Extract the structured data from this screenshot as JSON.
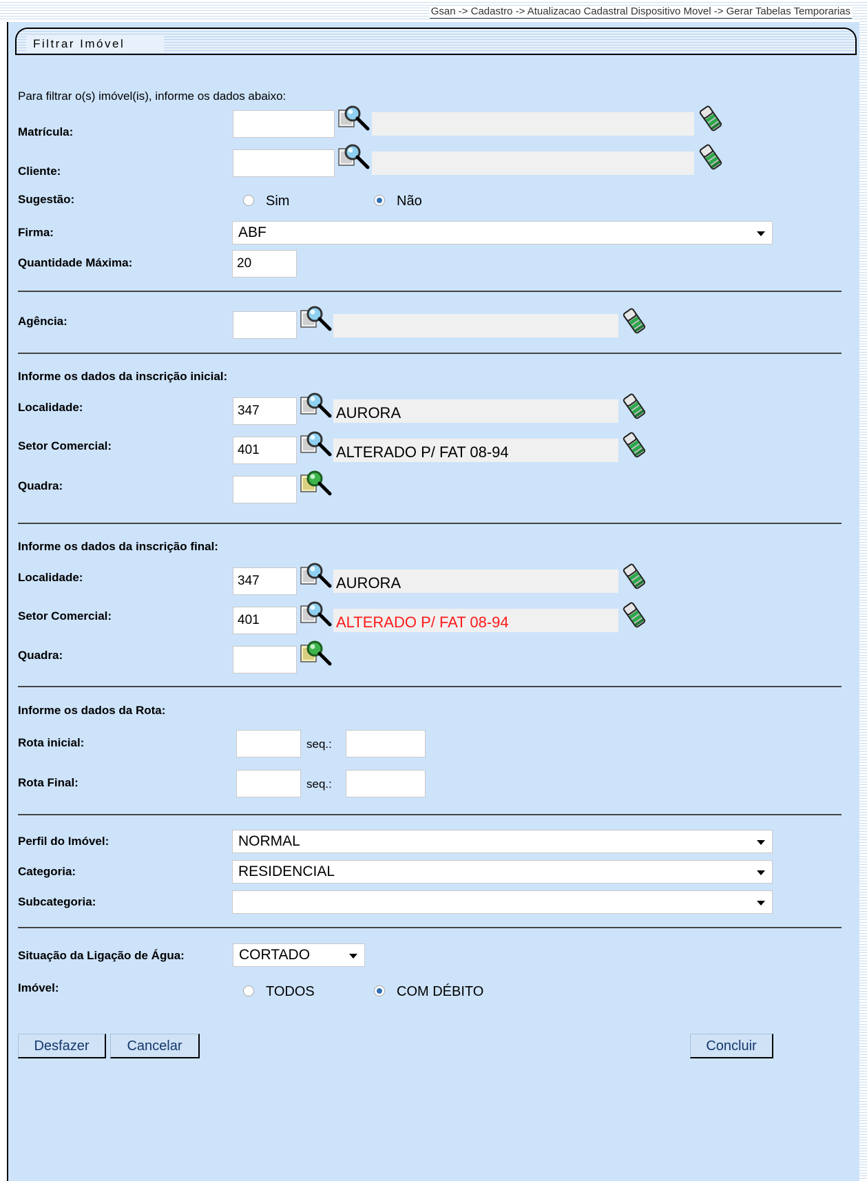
{
  "breadcrumb": "Gsan -> Cadastro -> Atualizacao Cadastral Dispositivo Movel -> Gerar Tabelas Temporarias",
  "panel_title": "Filtrar Imóvel",
  "intro": "Para filtrar o(s) imóvel(is), informe os dados abaixo:",
  "matricula": {
    "label": "Matrícula:",
    "value": "",
    "description": ""
  },
  "cliente": {
    "label": "Cliente:",
    "value": "",
    "description": ""
  },
  "sugestao": {
    "label": "Sugestão:",
    "options": [
      "Sim",
      "Não"
    ],
    "selected": "Não"
  },
  "firma": {
    "label": "Firma:",
    "selected": "ABF"
  },
  "quantidade_maxima": {
    "label": "Quantidade Máxima:",
    "value": "20"
  },
  "agencia": {
    "label": "Agência:",
    "value": "",
    "description": ""
  },
  "inscricao_inicial": {
    "heading": "Informe os dados da inscrição inicial:",
    "localidade_label": "Localidade:",
    "localidade_code": "347",
    "localidade_name": "AURORA",
    "setor_label": "Setor Comercial:",
    "setor_code": "401",
    "setor_name": "ALTERADO P/ FAT 08-94",
    "quadra_label": "Quadra:",
    "quadra_value": ""
  },
  "inscricao_final": {
    "heading": "Informe os dados da inscrição final:",
    "localidade_label": "Localidade:",
    "localidade_code": "347",
    "localidade_name": "AURORA",
    "setor_label": "Setor Comercial:",
    "setor_code": "401",
    "setor_name": "ALTERADO P/ FAT 08-94",
    "quadra_label": "Quadra:",
    "quadra_value": ""
  },
  "rota": {
    "heading": "Informe os dados da Rota:",
    "inicial_label": "Rota inicial:",
    "final_label": "Rota Final:",
    "seq_label": "seq.:"
  },
  "perfil": {
    "label": "Perfil do Imóvel:",
    "selected": "NORMAL"
  },
  "categoria": {
    "label": "Categoria:",
    "selected": "RESIDENCIAL"
  },
  "subcategoria": {
    "label": "Subcategoria:",
    "selected": ""
  },
  "situacao_agua": {
    "label": "Situação da Ligação de Água:",
    "selected": "CORTADO"
  },
  "imovel": {
    "label": "Imóvel:",
    "options": [
      "TODOS",
      "COM DÉBITO"
    ],
    "selected": "COM DÉBITO"
  },
  "buttons": {
    "desfazer": "Desfazer",
    "cancelar": "Cancelar",
    "concluir": "Concluir"
  },
  "colors": {
    "panel_bg": "#cde3fa",
    "error_text": "#ff1a1a",
    "button_text": "#15376b"
  }
}
